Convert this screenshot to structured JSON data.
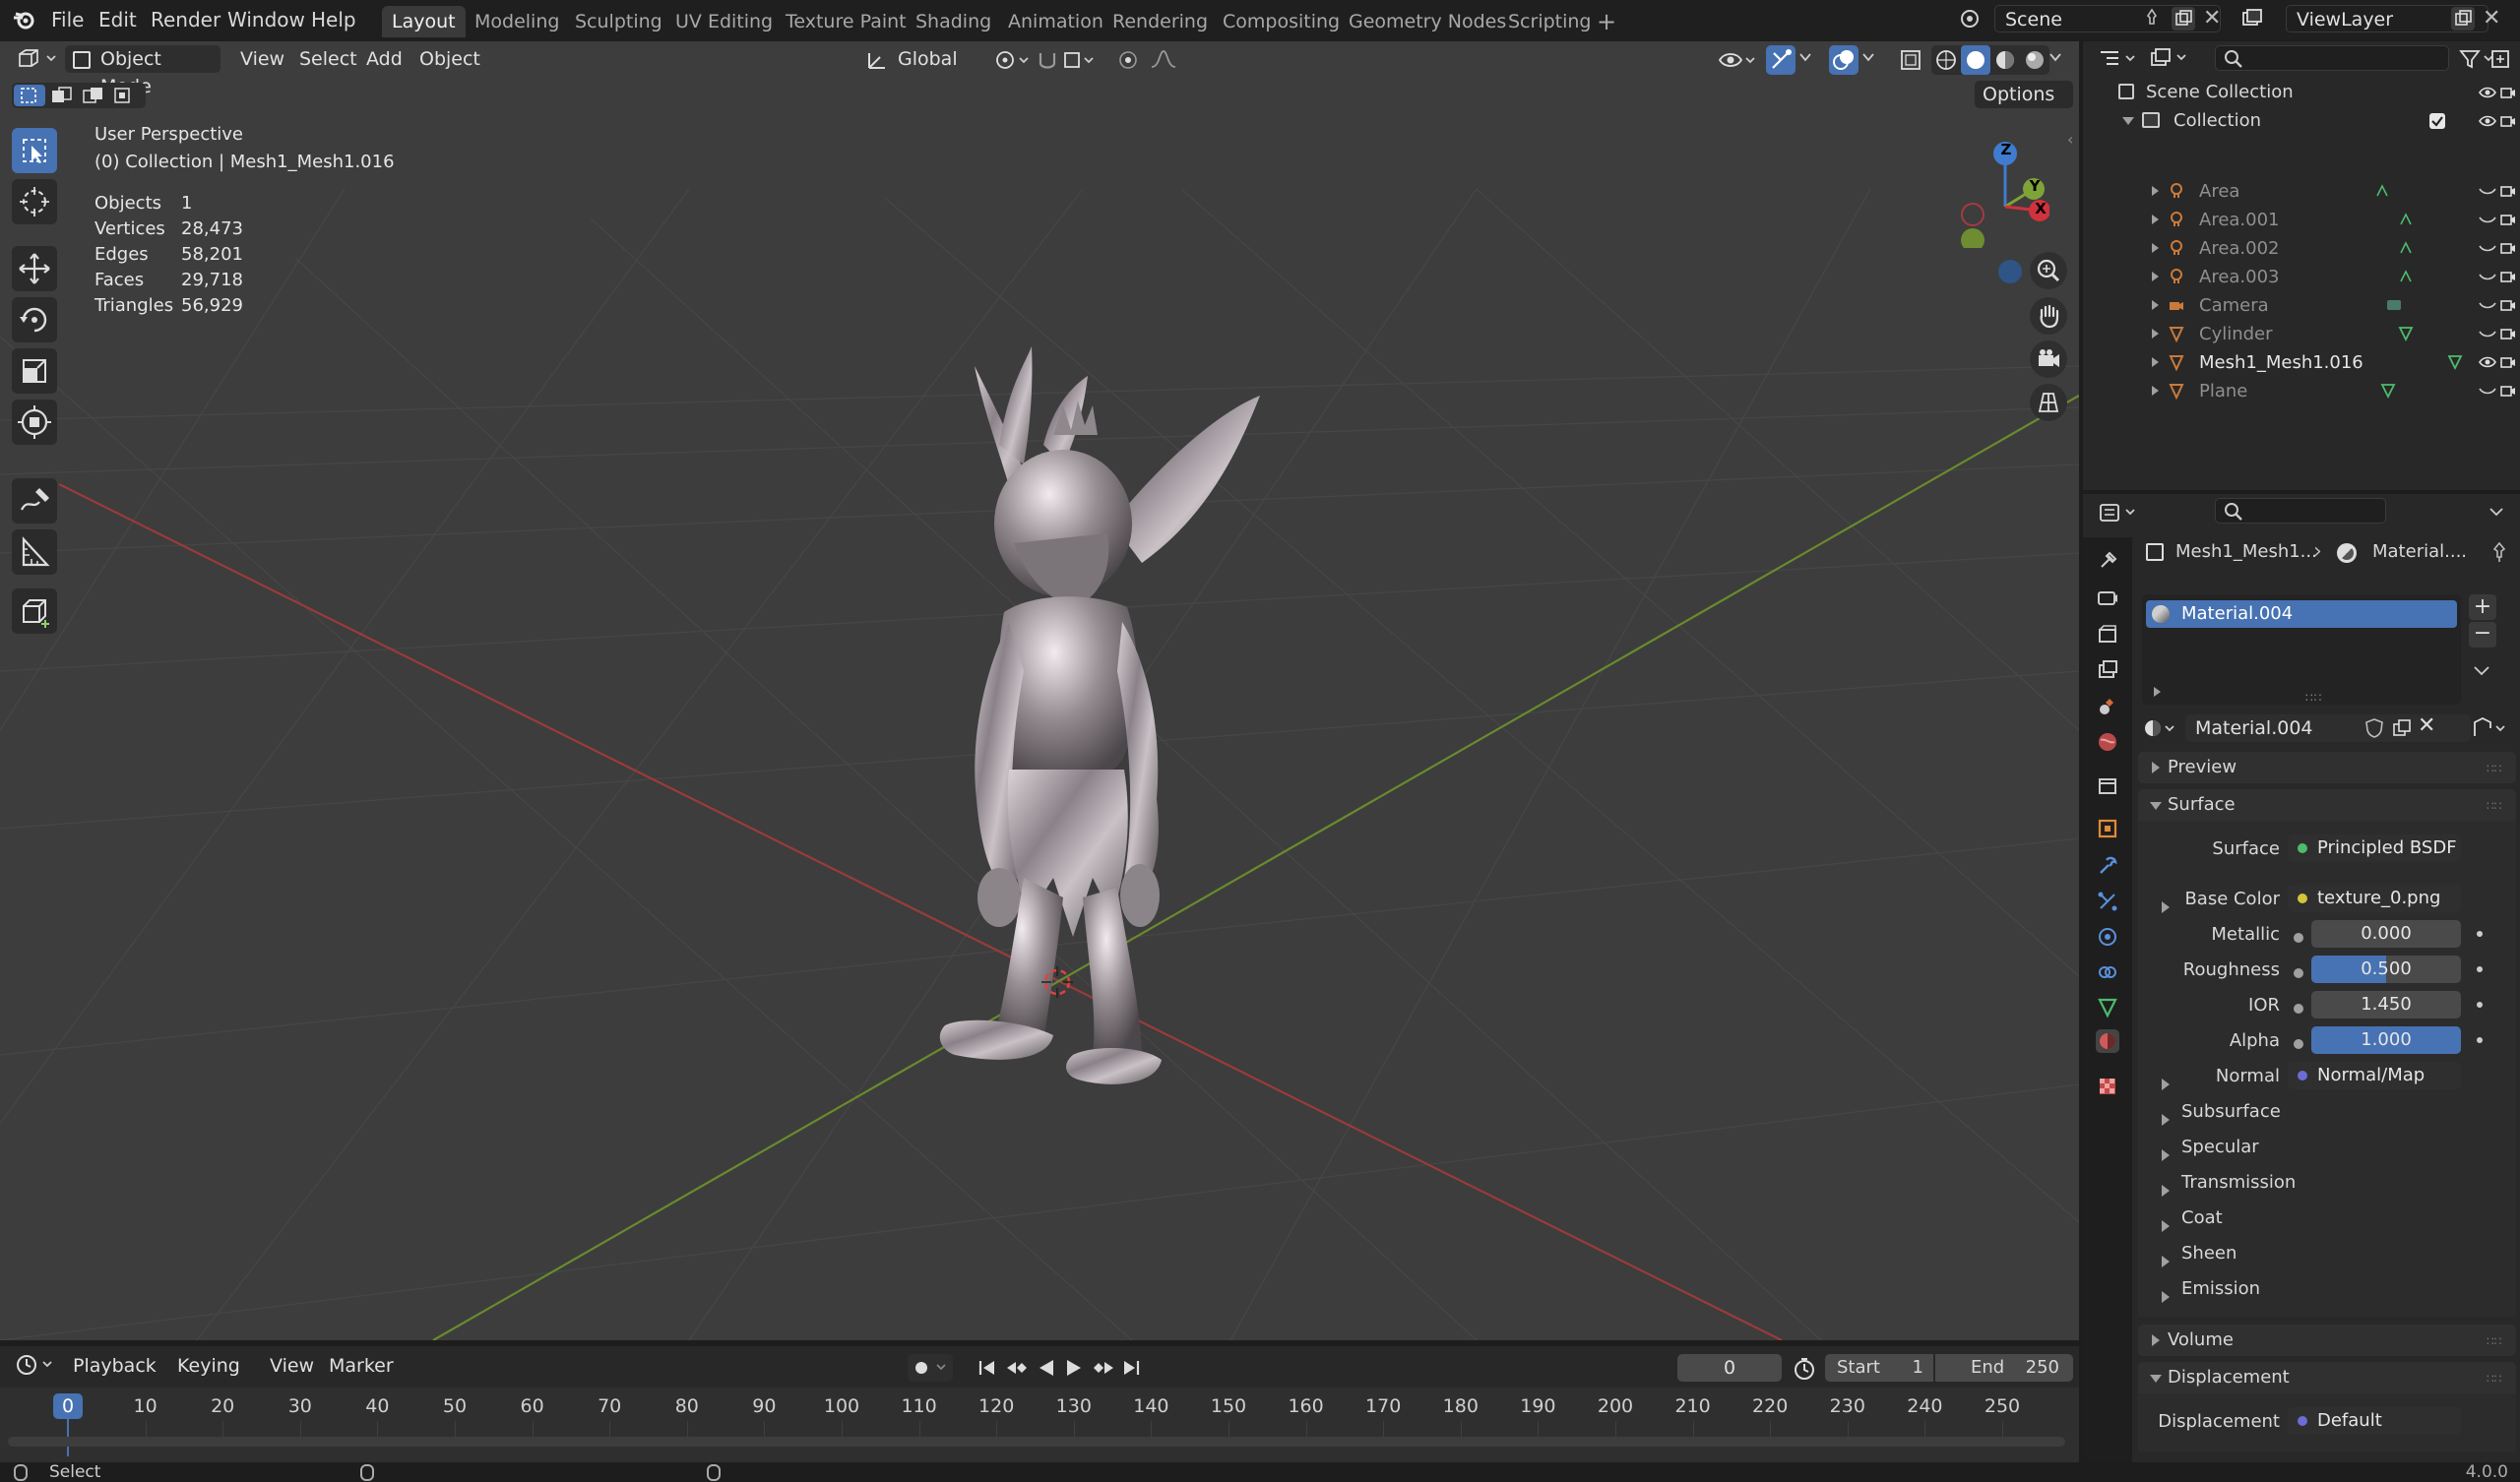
{
  "menu": [
    "File",
    "Edit",
    "Render",
    "Window",
    "Help"
  ],
  "workspaces": [
    "Layout",
    "Modeling",
    "Sculpting",
    "UV Editing",
    "Texture Paint",
    "Shading",
    "Animation",
    "Rendering",
    "Compositing",
    "Geometry Nodes",
    "Scripting"
  ],
  "active_workspace": "Layout",
  "scene": "Scene",
  "view_layer": "ViewLayer",
  "viewport": {
    "mode": "Object Mode",
    "menus": [
      "View",
      "Select",
      "Add",
      "Object"
    ],
    "transform_orientation": "Global",
    "options_label": "Options",
    "view_name": "User Perspective",
    "collection_line": "(0) Collection | Mesh1_Mesh1.016",
    "stats": [
      {
        "label": "Objects",
        "value": "1"
      },
      {
        "label": "Vertices",
        "value": "28,473"
      },
      {
        "label": "Edges",
        "value": "58,201"
      },
      {
        "label": "Faces",
        "value": "29,718"
      },
      {
        "label": "Triangles",
        "value": "56,929"
      }
    ],
    "gizmo": {
      "x": "X",
      "y": "Y",
      "z": "Z"
    }
  },
  "outliner": {
    "root": "Scene Collection",
    "collection": "Collection",
    "items": [
      {
        "name": "Area",
        "type": "light"
      },
      {
        "name": "Area.001",
        "type": "light"
      },
      {
        "name": "Area.002",
        "type": "light"
      },
      {
        "name": "Area.003",
        "type": "light"
      },
      {
        "name": "Camera",
        "type": "camera"
      },
      {
        "name": "Cylinder",
        "type": "mesh"
      },
      {
        "name": "Mesh1_Mesh1.016",
        "type": "mesh"
      },
      {
        "name": "Plane",
        "type": "mesh"
      }
    ]
  },
  "properties": {
    "breadcrumb_object": "Mesh1_Mesh1...",
    "breadcrumb_material": "Material....",
    "slot": "Material.004",
    "material_name": "Material.004",
    "panels": {
      "preview": "Preview",
      "surface": "Surface",
      "volume": "Volume",
      "displacement": "Displacement"
    },
    "surface_label": "Surface",
    "surface_value": "Principled BSDF",
    "base_color_label": "Base Color",
    "base_color_value": "texture_0.png",
    "metallic_label": "Metallic",
    "metallic_value": "0.000",
    "roughness_label": "Roughness",
    "roughness_value": "0.500",
    "roughness": 0.5,
    "ior_label": "IOR",
    "ior_value": "1.450",
    "alpha_label": "Alpha",
    "alpha_value": "1.000",
    "alpha": 1.0,
    "normal_label": "Normal",
    "normal_value": "Normal/Map",
    "subpanels": [
      "Subsurface",
      "Specular",
      "Transmission",
      "Coat",
      "Sheen",
      "Emission"
    ],
    "displacement_label": "Displacement",
    "displacement_value": "Default"
  },
  "timeline": {
    "menus": [
      "Playback",
      "Keying",
      "View",
      "Marker"
    ],
    "current_frame": "0",
    "start_label": "Start",
    "start": "1",
    "end_label": "End",
    "end": "250",
    "ticks": [
      "0",
      "10",
      "20",
      "30",
      "40",
      "50",
      "60",
      "70",
      "80",
      "90",
      "100",
      "110",
      "120",
      "130",
      "140",
      "150",
      "160",
      "170",
      "180",
      "190",
      "200",
      "210",
      "220",
      "230",
      "240",
      "250"
    ]
  },
  "status": {
    "left": "Select",
    "version": "4.0.0"
  }
}
